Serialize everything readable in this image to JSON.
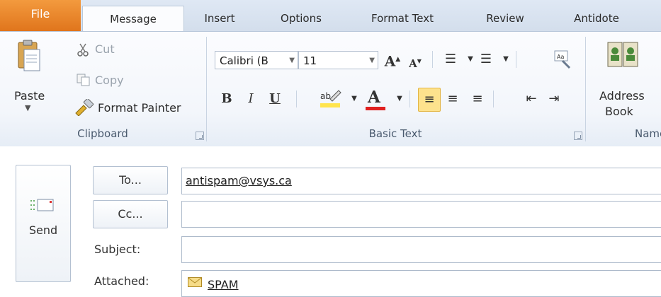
{
  "tabs": [
    "File",
    "Message",
    "Insert",
    "Options",
    "Format Text",
    "Review",
    "Antidote"
  ],
  "clipboard": {
    "paste": "Paste",
    "cut": "Cut",
    "copy": "Copy",
    "format_painter": "Format Painter",
    "group_label": "Clipboard"
  },
  "basic_text": {
    "font": "Calibri (B",
    "size": "11",
    "bold": "B",
    "italic": "I",
    "underline": "U",
    "font_color_glyph": "A",
    "grow_glyph": "A",
    "shrink_glyph": "A",
    "group_label": "Basic Text"
  },
  "names": {
    "address_book_line1": "Address",
    "address_book_line2": "Book",
    "group_label": "Name"
  },
  "compose": {
    "send": "Send",
    "to_button": "To...",
    "cc_button": "Cc...",
    "subject_label": "Subject:",
    "attached_label": "Attached:",
    "to_value": "antispam@vsys.ca",
    "cc_value": "",
    "subject_value": "",
    "attachment": "SPAM"
  },
  "colors": {
    "file_tab": "#e8821f",
    "accent_border": "#b9c8da",
    "highlight": "#ffe44d",
    "font_red": "#e02020"
  }
}
